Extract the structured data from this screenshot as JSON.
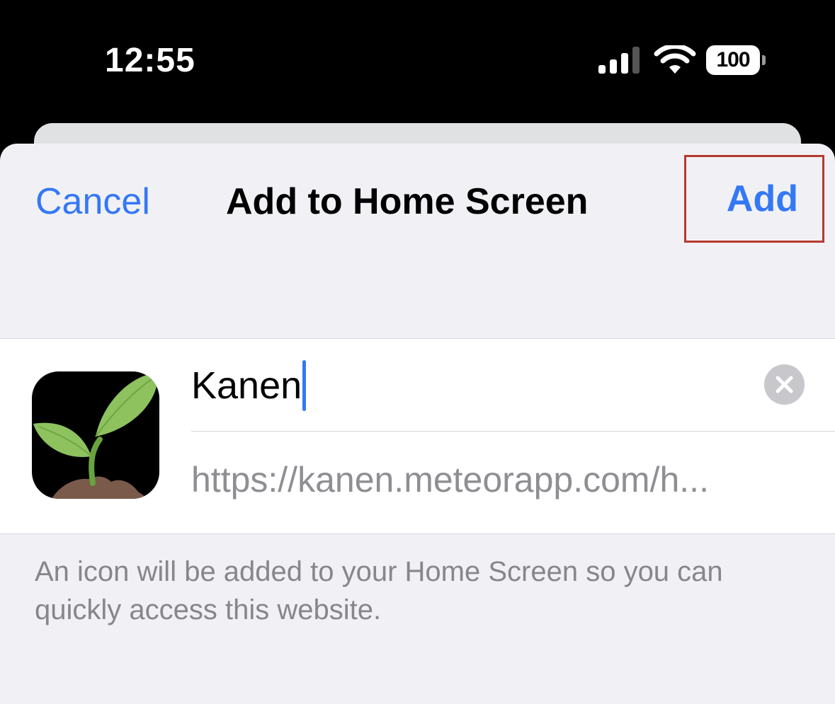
{
  "status_bar": {
    "time": "12:55",
    "battery": "100",
    "icons": [
      "signal-icon",
      "wifi-icon",
      "battery-icon"
    ]
  },
  "nav": {
    "cancel_label": "Cancel",
    "title": "Add to Home Screen",
    "add_label": "Add"
  },
  "form": {
    "app_icon": "seedling-icon",
    "name_value": "Kanen",
    "clear_icon": "clear-icon",
    "url": "https://kanen.meteorapp.com/h..."
  },
  "footer": {
    "note": "An icon will be added to your Home Screen so you can quickly access this website."
  },
  "colors": {
    "accent": "#3478f6",
    "highlight_border": "#b43a2e",
    "sheet_background": "#f1f1f5",
    "secondary_text": "#8e8e93"
  }
}
